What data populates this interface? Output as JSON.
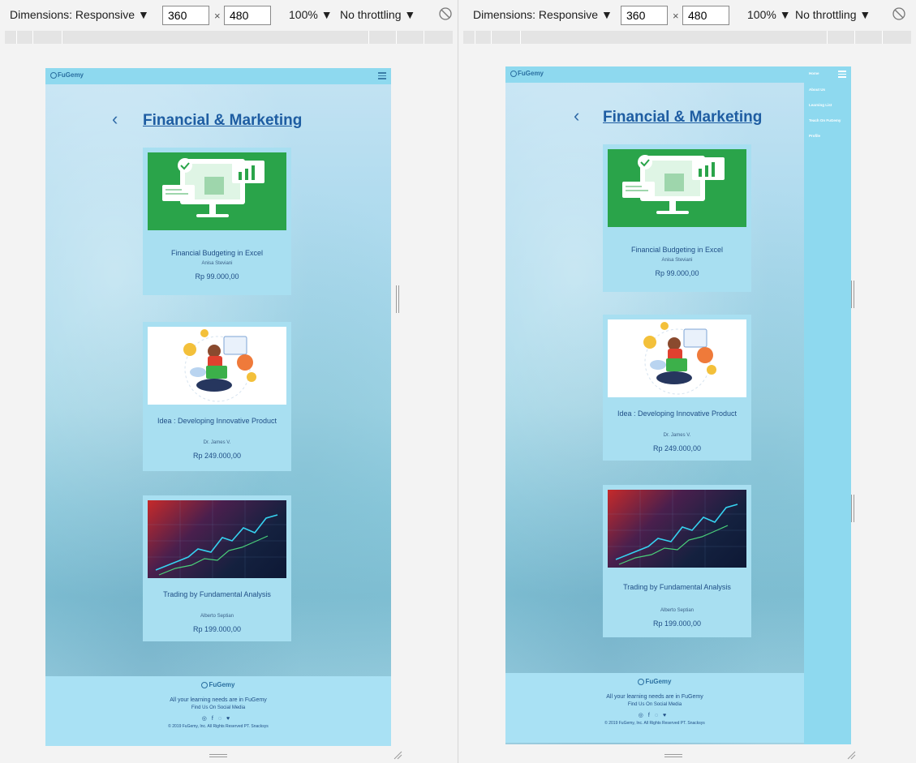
{
  "toolbar": {
    "dimensions_label": "Dimensions: Responsive ▼",
    "width": "360",
    "height": "480",
    "times": "×",
    "zoom": "100% ▼",
    "throttle": "No throttling ▼",
    "rotate_icon": "rotate-icon"
  },
  "page": {
    "logo": "FuGemy",
    "heading": "Financial & Marketing",
    "back_icon": "chevron-left-icon",
    "menu_icon": "hamburger-icon",
    "courses": [
      {
        "title": "Financial Budgeting in Excel",
        "author": "Anisa Steviani",
        "price": "Rp 99.000,00"
      },
      {
        "title": "Idea : Developing Innovative Product",
        "author": "Dr. James V.",
        "price": "Rp 249.000,00"
      },
      {
        "title": "Trading by Fundamental Analysis",
        "author": "Alberto Septian",
        "price": "Rp 199.000,00"
      }
    ],
    "footer": {
      "logo": "FuGemy",
      "line1": "All your learning needs are in FuGemy",
      "line2": "Find Us On Social Media",
      "social_icons": [
        "instagram-icon",
        "facebook-icon",
        "whatsapp-icon",
        "twitter-icon"
      ],
      "copyright": "© 2019 FuGemy, Inc. All Rights Reserved PT. Snacksys"
    }
  },
  "drawer": {
    "items": [
      "Home",
      "About Us",
      "Learning List",
      "Teach On FuGemy",
      "Profile"
    ]
  },
  "colors": {
    "appbar": "#8ed9ef",
    "card": "#a8dff1",
    "heading": "#1e5da2",
    "footer": "#a9e1f4"
  }
}
